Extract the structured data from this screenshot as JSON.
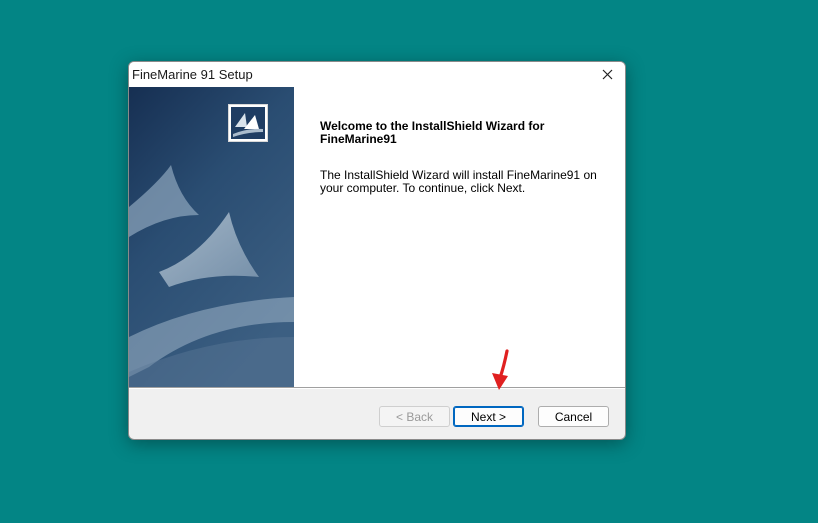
{
  "window": {
    "title": "FineMarine 91 Setup"
  },
  "wizard": {
    "heading": "Welcome to the InstallShield Wizard for FineMarine91",
    "body": "The InstallShield Wizard will install FineMarine91 on your computer.  To continue, click Next."
  },
  "buttons": {
    "back_label": "< Back",
    "next_label": "Next >",
    "cancel_label": "Cancel"
  },
  "icons": {
    "close": "close-icon",
    "logo": "installshield-logo-icon",
    "annotation": "red-arrow-icon"
  },
  "colors": {
    "desktop": "#038585",
    "panel_dark": "#1c3a5e",
    "accent": "#0067c0",
    "annotation": "#e02020"
  }
}
